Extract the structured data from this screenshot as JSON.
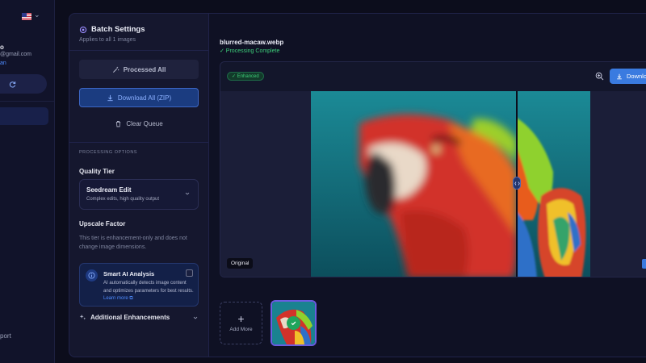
{
  "sidebar": {
    "user_name": "o",
    "user_email": "@gmail.com",
    "user_plan": "an",
    "support_label": "port"
  },
  "batch": {
    "title": "Batch Settings",
    "subtitle": "Applies to all 1 images",
    "processed_label": "Processed All",
    "download_label": "Download All (ZIP)",
    "clear_label": "Clear Queue",
    "section_label": "PROCESSING OPTIONS",
    "quality_label": "Quality Tier",
    "quality_value": "Seedream Edit",
    "quality_desc": "Complex edits, high quality output",
    "upscale_label": "Upscale Factor",
    "upscale_note": "This tier is enhancement-only and does not change image dimensions.",
    "ai_title": "Smart AI Analysis",
    "ai_desc": "AI automatically detects image content and optimizes parameters for best results.",
    "ai_link": "Learn more",
    "additional_label": "Additional Enhancements"
  },
  "main": {
    "file_name": "blurred-macaw.webp",
    "file_status": "✓ Processing Complete",
    "badge": "✓ Enhanced",
    "download_label": "Download",
    "original_label": "Original",
    "add_more_label": "Add More"
  },
  "colors": {
    "accent": "#3a7be0",
    "success": "#3ecf7a",
    "panel_bg": "#15172e"
  }
}
